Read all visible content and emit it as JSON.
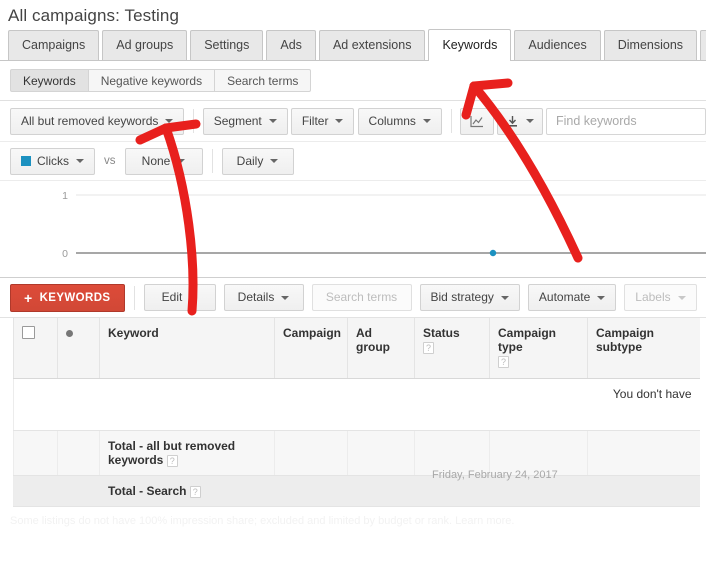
{
  "header": {
    "title": "All campaigns: Testing"
  },
  "primary_tabs": [
    {
      "label": "Campaigns",
      "selected": false
    },
    {
      "label": "Ad groups",
      "selected": false
    },
    {
      "label": "Settings",
      "selected": false
    },
    {
      "label": "Ads",
      "selected": false
    },
    {
      "label": "Ad extensions",
      "selected": false
    },
    {
      "label": "Keywords",
      "selected": true
    },
    {
      "label": "Audiences",
      "selected": false
    },
    {
      "label": "Dimensions",
      "selected": false
    }
  ],
  "primary_tabs_more": {
    "icon": "chevron-down-icon",
    "glyph": "▼"
  },
  "sub_tabs": [
    {
      "label": "Keywords",
      "selected": true
    },
    {
      "label": "Negative keywords",
      "selected": false
    },
    {
      "label": "Search terms",
      "selected": false
    }
  ],
  "filter_bar": {
    "status_filter": "All but removed keywords",
    "segment": "Segment",
    "filter": "Filter",
    "columns": "Columns",
    "chart_icon": "line-chart-icon",
    "download_icon": "download-icon",
    "download_glyph": "⬇",
    "find_placeholder": "Find keywords"
  },
  "metric_bar": {
    "metric_primary": "Clicks",
    "metric_primary_color": "#1c91c0",
    "vs_label": "vs",
    "metric_secondary": "None",
    "granularity": "Daily"
  },
  "chart_data": {
    "type": "line",
    "title": "",
    "xlabel": "",
    "ylabel": "Clicks",
    "ytick_labels": [
      "1",
      "0"
    ],
    "ylim": [
      0,
      1
    ],
    "x": [
      "Friday, February 24, 2017"
    ],
    "series": [
      {
        "name": "Clicks",
        "color": "#1c91c0",
        "values": [
          0
        ]
      }
    ],
    "annotation": "Friday, February 24, 2017",
    "grid": true,
    "legend": "none",
    "highlight_point": {
      "x_label": "Friday, February 24, 2017",
      "y": 0
    }
  },
  "action_bar": {
    "add_keywords": "KEYWORDS",
    "add_icon": "plus-icon",
    "edit": "Edit",
    "details": "Details",
    "search_terms": "Search terms",
    "bid_strategy": "Bid strategy",
    "automate": "Automate",
    "labels": "Labels"
  },
  "table": {
    "columns": [
      {
        "label": "",
        "icon": "select-all-checkbox"
      },
      {
        "label": "",
        "icon": "status-dot-icon"
      },
      {
        "label": "Keyword",
        "help": false
      },
      {
        "label": "Campaign",
        "help": false
      },
      {
        "label": "Ad group",
        "help": false
      },
      {
        "label": "Status",
        "help": true
      },
      {
        "label": "Campaign type",
        "help": true
      },
      {
        "label": "Campaign subtype",
        "help": false
      }
    ],
    "help_glyph": "?",
    "empty_message": "You don't have",
    "rows": [
      {
        "type": "total",
        "label": "Total - all but removed keywords",
        "help": true
      },
      {
        "type": "total-search",
        "label": "Total - Search",
        "help": true
      }
    ]
  },
  "footnote": {
    "text": "Some listings do not have 100% impression share; excluded and limited by budget or rank. Learn more."
  }
}
